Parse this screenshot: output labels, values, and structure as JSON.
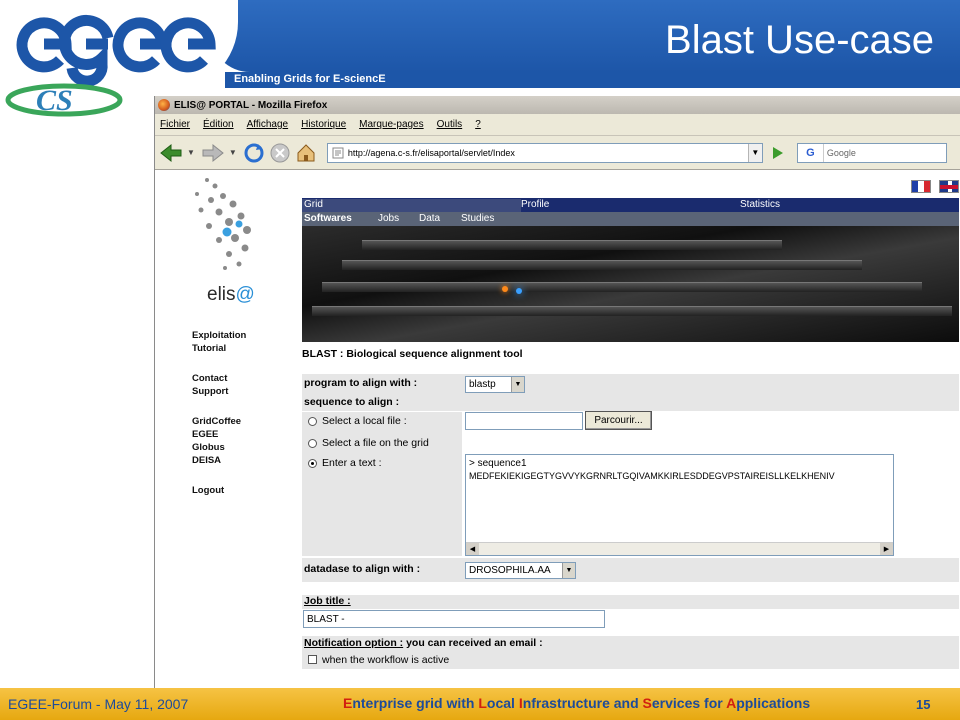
{
  "slide": {
    "title": "Blast Use-case",
    "tagline": "Enabling Grids for E-sciencE",
    "logo_text": "egee",
    "logo_sub": "CS"
  },
  "browser": {
    "window_title": "ELIS@ PORTAL - Mozilla Firefox",
    "menu": [
      "Fichier",
      "Édition",
      "Affichage",
      "Historique",
      "Marque-pages",
      "Outils",
      "?"
    ],
    "url": "http://agena.c-s.fr/elisaportal/servlet/Index",
    "search_placeholder": "Google",
    "search_engine_letter": "G"
  },
  "portal": {
    "logo_text": "elis",
    "logo_at": "@",
    "nav_groups": [
      [
        "Exploitation",
        "Tutorial"
      ],
      [
        "Contact",
        "Support"
      ],
      [
        "GridCoffee",
        "EGEE",
        "Globus",
        "DEISA"
      ],
      [
        "Logout"
      ]
    ],
    "top_tabs": [
      "Grid",
      "Profile",
      "Statistics"
    ],
    "sub_tabs": [
      "Softwares",
      "Jobs",
      "Data",
      "Studies"
    ]
  },
  "form": {
    "section_title": "BLAST : Biological sequence alignment tool",
    "program_label": "program to align with :",
    "program_value": "blastp",
    "sequence_label": "sequence to align :",
    "opt_local_file": "Select a local file :",
    "browse_button": "Parcourir...",
    "opt_grid_file": "Select a file on the grid",
    "opt_text": "Enter a text :",
    "sequence_text": [
      "> sequence1",
      "MEDFEKIEKIGEGTYGVVYKGRNRLTGQIVAMKKIRLESDDEGVPSTAIREISLLKELKHENIV"
    ],
    "database_label": "datadase to align with :",
    "database_value": "DROSOPHILA.AA",
    "job_title_label": "Job title :",
    "job_title_value": "BLAST -",
    "notification_label": "Notification option :",
    "notification_hint": "you can received an email :",
    "notify_checkbox": "when the workflow is active"
  },
  "footer": {
    "left": "EGEE-Forum - May 11, 2007",
    "mid": [
      {
        "hl": "E",
        "rest": "nterprise grid with "
      },
      {
        "hl": "L",
        "rest": "ocal "
      },
      {
        "hl": "I",
        "rest": "nfrastructure and "
      },
      {
        "hl": "S",
        "rest": "ervices for "
      },
      {
        "hl": "A",
        "rest": "pplications"
      }
    ],
    "page": "15"
  },
  "colors": {
    "header_blue": "#1d56a8",
    "footer_gold": "#f0b62a",
    "footer_text": "#1d4b9a",
    "footer_highlight": "#d22010",
    "nav_dark": "#1a2b6e"
  }
}
